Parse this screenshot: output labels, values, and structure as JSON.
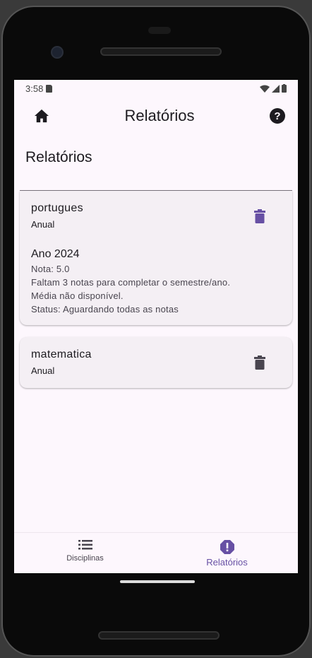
{
  "status_bar": {
    "time": "3:58"
  },
  "app_bar": {
    "title": "Relatórios",
    "left_icon": "home-icon",
    "right_icon": "help-icon"
  },
  "page": {
    "heading": "Relatórios"
  },
  "cards": [
    {
      "name": "portugues",
      "type": "Anual",
      "expanded": true,
      "year": "Ano 2024",
      "lines": [
        "Nota: 5.0",
        "Faltam 3 notas para completar o semestre/ano.",
        "Média não disponível.",
        "Status: Aguardando todas as notas"
      ],
      "trash_color": "#6750a4"
    },
    {
      "name": "matematica",
      "type": "Anual",
      "expanded": false,
      "trash_color": "#49454f"
    }
  ],
  "bottom_nav": {
    "items": [
      {
        "label": "Disciplinas",
        "icon": "list-icon",
        "active": false
      },
      {
        "label": "Relatórios",
        "icon": "report-icon",
        "active": true
      }
    ]
  },
  "colors": {
    "accent": "#6750a4",
    "background": "#fdf7fd"
  }
}
